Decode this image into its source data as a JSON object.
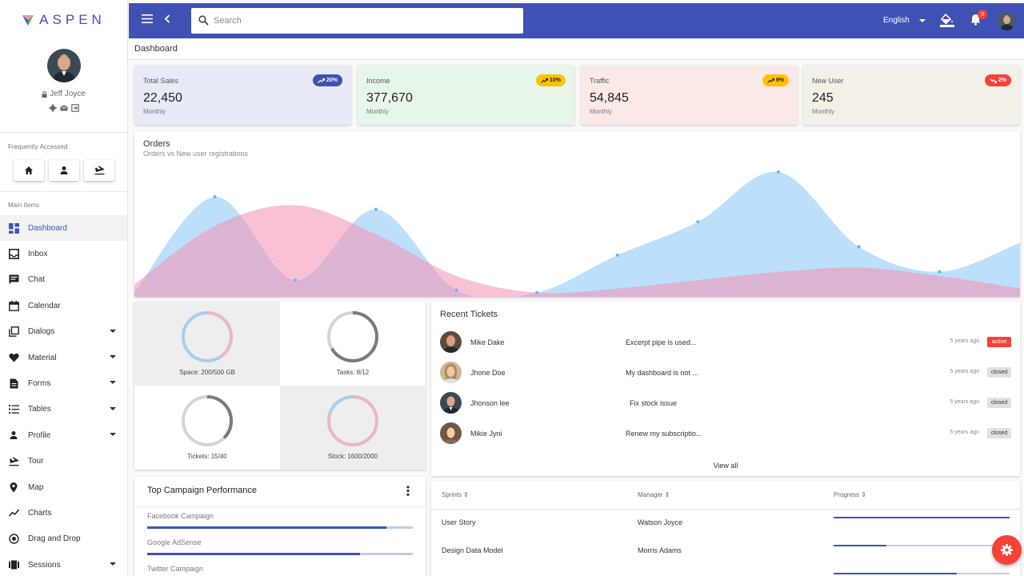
{
  "app": {
    "logo_text": "ASPEN"
  },
  "user": {
    "name": "Jeff Joyce"
  },
  "sidebar": {
    "frequent_label": "Frequently Accessed",
    "frequent_icons": [
      "home-icon",
      "person-icon",
      "flight-land-icon"
    ],
    "main_label": "Main Items",
    "items": [
      {
        "label": "Dashboard",
        "icon": "dashboard-icon",
        "expandable": false,
        "active": true
      },
      {
        "label": "Inbox",
        "icon": "inbox-icon",
        "expandable": false
      },
      {
        "label": "Chat",
        "icon": "chat-icon",
        "expandable": false
      },
      {
        "label": "Calendar",
        "icon": "calendar-icon",
        "expandable": false
      },
      {
        "label": "Dialogs",
        "icon": "dialogs-icon",
        "expandable": true
      },
      {
        "label": "Material",
        "icon": "heart-icon",
        "expandable": true
      },
      {
        "label": "Forms",
        "icon": "document-icon",
        "expandable": true
      },
      {
        "label": "Tables",
        "icon": "list-icon",
        "expandable": true
      },
      {
        "label": "Profile",
        "icon": "person-icon",
        "expandable": true
      },
      {
        "label": "Tour",
        "icon": "flight-icon",
        "expandable": false
      },
      {
        "label": "Map",
        "icon": "pin-icon",
        "expandable": false
      },
      {
        "label": "Charts",
        "icon": "chart-line-icon",
        "expandable": false
      },
      {
        "label": "Drag and Drop",
        "icon": "radio-icon",
        "expandable": false
      },
      {
        "label": "Sessions",
        "icon": "sessions-icon",
        "expandable": true
      }
    ]
  },
  "topbar": {
    "search_placeholder": "Search",
    "language": "English",
    "notification_count": "3",
    "accent": "#3f51b5"
  },
  "breadcrumb": "Dashboard",
  "stats": [
    {
      "title": "Total Sales",
      "value": "22,450",
      "sub": "Monthly",
      "badge": "20%",
      "trend": "up",
      "bg": "#e8eaf6",
      "badge_bg": "#3f51b5",
      "badge_color": "#ffffff"
    },
    {
      "title": "Income",
      "value": "377,670",
      "sub": "Monthly",
      "badge": "10%",
      "trend": "up",
      "bg": "#e8f5e9",
      "badge_bg": "#ffc107",
      "badge_color": "#222222"
    },
    {
      "title": "Traffic",
      "value": "54,845",
      "sub": "Monthly",
      "badge": "9%",
      "trend": "up",
      "bg": "#fbe9e7",
      "badge_bg": "#ffc107",
      "badge_color": "#222222"
    },
    {
      "title": "New User",
      "value": "245",
      "sub": "Monthly",
      "badge": "2%",
      "trend": "down",
      "bg": "#f3f0e8",
      "badge_bg": "#f44336",
      "badge_color": "#ffffff"
    }
  ],
  "orders": {
    "title": "Orders",
    "subtitle": "Orders vs New user registrations"
  },
  "chart_data": {
    "type": "area",
    "x": [
      0,
      1,
      2,
      3,
      4,
      5,
      6,
      7,
      8,
      9,
      10,
      11
    ],
    "series": [
      {
        "color": "#90caf9",
        "values": [
          5,
          120,
          20,
          105,
          8,
          5,
          50,
          90,
          150,
          60,
          30,
          65
        ]
      },
      {
        "color": "#f48fb1",
        "values": [
          15,
          85,
          110,
          75,
          25,
          5,
          10,
          20,
          30,
          35,
          25,
          10
        ]
      }
    ],
    "ylim": [
      0,
      170
    ],
    "grid": false
  },
  "donuts": [
    {
      "label": "Space: 200/500 GB",
      "style": "pastel",
      "value": 0.4,
      "bg": "#eeeeee"
    },
    {
      "label": "Tasks: 8/12",
      "style": "gray",
      "value": 0.667,
      "bg": "#ffffff"
    },
    {
      "label": "Tickets: 15/40",
      "style": "gray",
      "value": 0.375,
      "bg": "#ffffff"
    },
    {
      "label": "Stock: 1600/2000",
      "style": "pastel",
      "value": 0.8,
      "bg": "#eeeeee"
    }
  ],
  "campaign": {
    "title": "Top Campaign Performance",
    "items": [
      {
        "name": "Facebook Campaign",
        "value": 0.9
      },
      {
        "name": "Google AdSense",
        "value": 0.8
      },
      {
        "name": "Twitter Campaign",
        "value": 0.7
      }
    ]
  },
  "tickets": {
    "title": "Recent Tickets",
    "view_all": "View all",
    "rows": [
      {
        "name": "Mike Dake",
        "message": "Excerpt pipe is used...",
        "time": "5 years ago",
        "status": "active"
      },
      {
        "name": "Jhone Doe",
        "message": "My dashboard is not ...",
        "time": "5 years ago",
        "status": "closed"
      },
      {
        "name": "Jhonson lee",
        "message": "Fix stock issue",
        "time": "5 years ago",
        "status": "closed"
      },
      {
        "name": "Mikie Jyni",
        "message": "Renew my subscriptio...",
        "time": "5 years ago",
        "status": "closed"
      }
    ]
  },
  "sprints": {
    "headers": [
      "Sprints",
      "Manager",
      "Progress"
    ],
    "rows": [
      {
        "sprint": "User Story",
        "manager": "Watson Joyce",
        "progress": 1.0
      },
      {
        "sprint": "Design Data Model",
        "manager": "Morris Adams",
        "progress": 0.3
      },
      {
        "sprint": "",
        "manager": "",
        "progress": 0.7
      }
    ]
  }
}
